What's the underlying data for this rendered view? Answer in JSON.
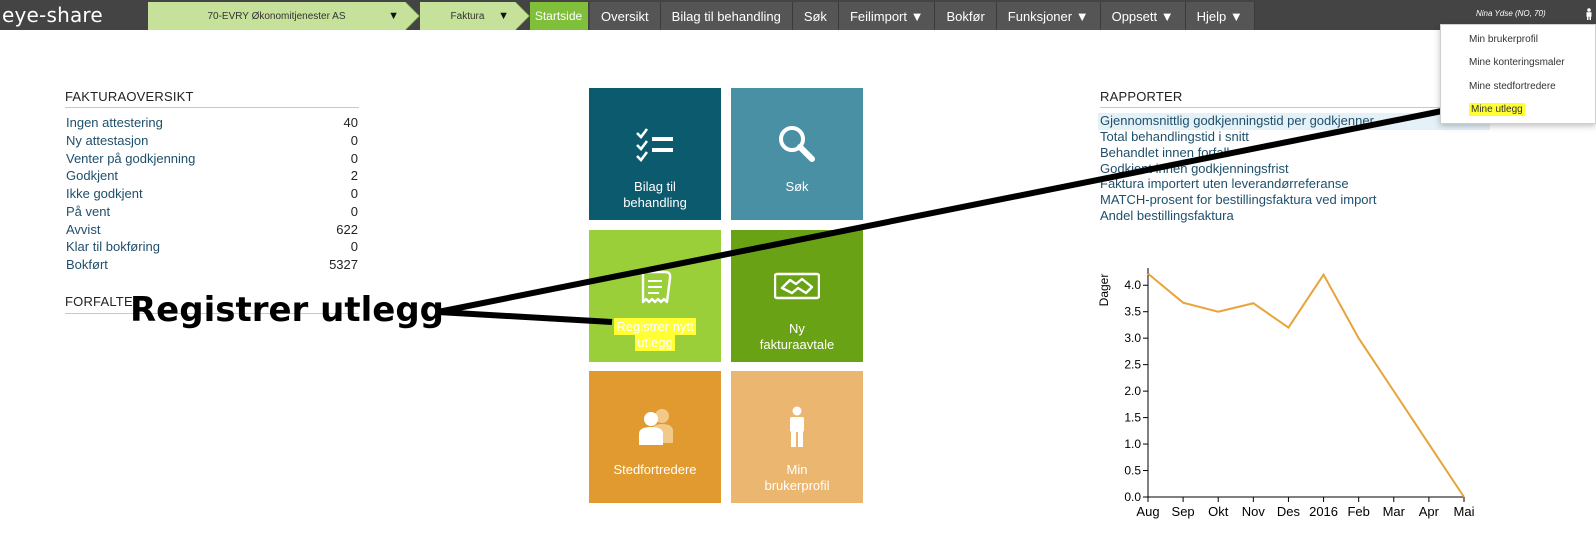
{
  "app": {
    "brand": "eye-share"
  },
  "breadcrumb": [
    {
      "label": "70-EVRY Økonomitjenester AS",
      "dropdown": "▼"
    },
    {
      "label": "Faktura",
      "dropdown": "▼"
    },
    {
      "label": "Startside"
    }
  ],
  "nav": [
    {
      "label": "Oversikt"
    },
    {
      "label": "Bilag til behandling"
    },
    {
      "label": "Søk"
    },
    {
      "label": "Feilimport ▼"
    },
    {
      "label": "Bokfør"
    },
    {
      "label": "Funksjoner ▼"
    },
    {
      "label": "Oppsett ▼"
    },
    {
      "label": "Hjelp ▼"
    }
  ],
  "user": {
    "label": "Nina Ydse (NO, 70)",
    "menu": [
      {
        "label": "Min brukerprofil"
      },
      {
        "label": "Mine konteringsmaler"
      },
      {
        "label": "Mine stedfortredere"
      },
      {
        "label": "Mine utlegg",
        "highlighted": true
      }
    ]
  },
  "fakturaoversikt": {
    "title": "FAKTURAOVERSIKT",
    "rows": [
      {
        "label": "Ingen attestering",
        "value": "40"
      },
      {
        "label": "Ny attestasjon",
        "value": "0"
      },
      {
        "label": "Venter på godkjenning",
        "value": "0"
      },
      {
        "label": "Godkjent",
        "value": "2"
      },
      {
        "label": "Ikke godkjent",
        "value": "0"
      },
      {
        "label": "På vent",
        "value": "0"
      },
      {
        "label": "Avvist",
        "value": "622"
      },
      {
        "label": "Klar til bokføring",
        "value": "0"
      },
      {
        "label": "Bokført",
        "value": "5327"
      }
    ]
  },
  "forfalte": {
    "title": "FORFALTE"
  },
  "tiles": [
    {
      "label_line1": "Bilag til",
      "label_line2": "behandling",
      "icon": "checklist-icon",
      "color": "#0c5a6e"
    },
    {
      "label_line1": "Søk",
      "label_line2": "",
      "icon": "search-icon",
      "color": "#4a90a4"
    },
    {
      "label_line1": "Registrer nytt",
      "label_line2": "utlegg",
      "icon": "receipt-icon",
      "color": "#9bcf3a"
    },
    {
      "label_line1": "Ny",
      "label_line2": "fakturaavtale",
      "icon": "handshake-icon",
      "color": "#6aa215"
    },
    {
      "label_line1": "Stedfortredere",
      "label_line2": "",
      "icon": "users-icon",
      "color": "#e09a30"
    },
    {
      "label_line1": "Min",
      "label_line2": "brukerprofil",
      "icon": "person-icon",
      "color": "#ebb670"
    }
  ],
  "rapporter": {
    "title": "RAPPORTER",
    "links": [
      {
        "label": "Gjennomsnittlig godkjenningstid per godkjenner"
      },
      {
        "label": "Total behandlingstid i snitt"
      },
      {
        "label": "Behandlet innen forfall"
      },
      {
        "label": "Godkjent innen godkjenningsfrist"
      },
      {
        "label": "Faktura importert uten leverandørreferanse"
      },
      {
        "label": "MATCH-prosent for bestillingsfaktura ved import"
      },
      {
        "label": "Andel bestillingsfaktura"
      }
    ]
  },
  "annotation": {
    "text": "Registrer utlegg"
  },
  "chart_data": {
    "type": "line",
    "ylabel": "Dager",
    "xlabel": "",
    "categories": [
      "Aug",
      "Sep",
      "Okt",
      "Nov",
      "Des",
      "2016",
      "Feb",
      "Mar",
      "Apr",
      "Mai"
    ],
    "yticks": [
      "0.0",
      "0.5",
      "1.0",
      "1.5",
      "2.0",
      "2.5",
      "3.0",
      "3.5",
      "4.0"
    ],
    "ylim": [
      0,
      4.25
    ],
    "series": [
      {
        "values": [
          4.22,
          3.67,
          3.5,
          3.66,
          3.2,
          4.2,
          3.0,
          2.0,
          1.0,
          0.0
        ],
        "color": "#e8a33a"
      }
    ],
    "grid": false
  }
}
